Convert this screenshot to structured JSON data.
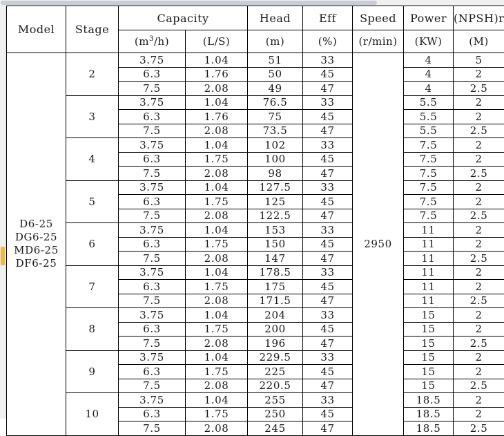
{
  "table": {
    "columns": {
      "model": "Model",
      "stage": "Stage",
      "capacity": "Capacity",
      "capacity_m3h": "(m³/h)",
      "capacity_ls": "(L/S)",
      "head": "Head",
      "head_unit": "(m)",
      "eff": "Eff",
      "eff_unit": "(%)",
      "speed": "Speed",
      "speed_unit": "(r/min)",
      "power": "Power",
      "power_unit": "(KW)",
      "npsh": "(NPSH)r",
      "npsh_unit": "(M)"
    },
    "model_names": [
      "D6-25",
      "DG6-25",
      "MD6-25",
      "DF6-25"
    ],
    "speed_value": "2950",
    "groups": [
      {
        "stage": "2",
        "rows": [
          {
            "capacity_m3h": "3.75",
            "capacity_ls": "1.04",
            "head": "51",
            "eff": "33",
            "power": "4",
            "npsh": "5"
          },
          {
            "capacity_m3h": "6.3",
            "capacity_ls": "1.76",
            "head": "50",
            "eff": "45",
            "power": "4",
            "npsh": "2"
          },
          {
            "capacity_m3h": "7.5",
            "capacity_ls": "2.08",
            "head": "49",
            "eff": "47",
            "power": "4",
            "npsh": "2.5"
          }
        ]
      },
      {
        "stage": "3",
        "rows": [
          {
            "capacity_m3h": "3.75",
            "capacity_ls": "1.04",
            "head": "76.5",
            "eff": "33",
            "power": "5.5",
            "npsh": "2"
          },
          {
            "capacity_m3h": "6.3",
            "capacity_ls": "1.76",
            "head": "75",
            "eff": "45",
            "power": "5.5",
            "npsh": "2"
          },
          {
            "capacity_m3h": "7.5",
            "capacity_ls": "2.08",
            "head": "73.5",
            "eff": "47",
            "power": "5.5",
            "npsh": "2.5"
          }
        ]
      },
      {
        "stage": "4",
        "rows": [
          {
            "capacity_m3h": "3.75",
            "capacity_ls": "1.04",
            "head": "102",
            "eff": "33",
            "power": "7.5",
            "npsh": "2"
          },
          {
            "capacity_m3h": "6.3",
            "capacity_ls": "1.75",
            "head": "100",
            "eff": "45",
            "power": "7.5",
            "npsh": "2"
          },
          {
            "capacity_m3h": "7.5",
            "capacity_ls": "2.08",
            "head": "98",
            "eff": "47",
            "power": "7.5",
            "npsh": "2.5"
          }
        ]
      },
      {
        "stage": "5",
        "rows": [
          {
            "capacity_m3h": "3.75",
            "capacity_ls": "1.04",
            "head": "127.5",
            "eff": "33",
            "power": "7.5",
            "npsh": "2"
          },
          {
            "capacity_m3h": "6.3",
            "capacity_ls": "1.75",
            "head": "125",
            "eff": "45",
            "power": "7.5",
            "npsh": "2"
          },
          {
            "capacity_m3h": "7.5",
            "capacity_ls": "2.08",
            "head": "122.5",
            "eff": "47",
            "power": "7.5",
            "npsh": "2.5"
          }
        ]
      },
      {
        "stage": "6",
        "rows": [
          {
            "capacity_m3h": "3.75",
            "capacity_ls": "1.04",
            "head": "153",
            "eff": "33",
            "power": "11",
            "npsh": "2"
          },
          {
            "capacity_m3h": "6.3",
            "capacity_ls": "1.75",
            "head": "150",
            "eff": "45",
            "power": "11",
            "npsh": "2"
          },
          {
            "capacity_m3h": "7.5",
            "capacity_ls": "2.08",
            "head": "147",
            "eff": "47",
            "power": "11",
            "npsh": "2.5"
          }
        ]
      },
      {
        "stage": "7",
        "rows": [
          {
            "capacity_m3h": "3.75",
            "capacity_ls": "1.04",
            "head": "178.5",
            "eff": "33",
            "power": "11",
            "npsh": "2"
          },
          {
            "capacity_m3h": "6.3",
            "capacity_ls": "1.75",
            "head": "175",
            "eff": "45",
            "power": "11",
            "npsh": "2"
          },
          {
            "capacity_m3h": "7.5",
            "capacity_ls": "2.08",
            "head": "171.5",
            "eff": "47",
            "power": "11",
            "npsh": "2.5"
          }
        ]
      },
      {
        "stage": "8",
        "rows": [
          {
            "capacity_m3h": "3.75",
            "capacity_ls": "1.04",
            "head": "204",
            "eff": "33",
            "power": "15",
            "npsh": "2"
          },
          {
            "capacity_m3h": "6.3",
            "capacity_ls": "1.75",
            "head": "200",
            "eff": "45",
            "power": "15",
            "npsh": "2"
          },
          {
            "capacity_m3h": "7.5",
            "capacity_ls": "2.08",
            "head": "196",
            "eff": "47",
            "power": "15",
            "npsh": "2.5"
          }
        ]
      },
      {
        "stage": "9",
        "rows": [
          {
            "capacity_m3h": "3.75",
            "capacity_ls": "1.04",
            "head": "229.5",
            "eff": "33",
            "power": "15",
            "npsh": "2"
          },
          {
            "capacity_m3h": "6.3",
            "capacity_ls": "1.75",
            "head": "225",
            "eff": "45",
            "power": "15",
            "npsh": "2"
          },
          {
            "capacity_m3h": "7.5",
            "capacity_ls": "2.08",
            "head": "220.5",
            "eff": "47",
            "power": "15",
            "npsh": "2.5"
          }
        ]
      },
      {
        "stage": "10",
        "rows": [
          {
            "capacity_m3h": "3.75",
            "capacity_ls": "1.04",
            "head": "255",
            "eff": "33",
            "power": "18.5",
            "npsh": "2"
          },
          {
            "capacity_m3h": "6.3",
            "capacity_ls": "1.75",
            "head": "250",
            "eff": "45",
            "power": "18.5",
            "npsh": "2"
          },
          {
            "capacity_m3h": "7.5",
            "capacity_ls": "2.08",
            "head": "245",
            "eff": "47",
            "power": "18.5",
            "npsh": "2.5"
          }
        ]
      }
    ]
  }
}
